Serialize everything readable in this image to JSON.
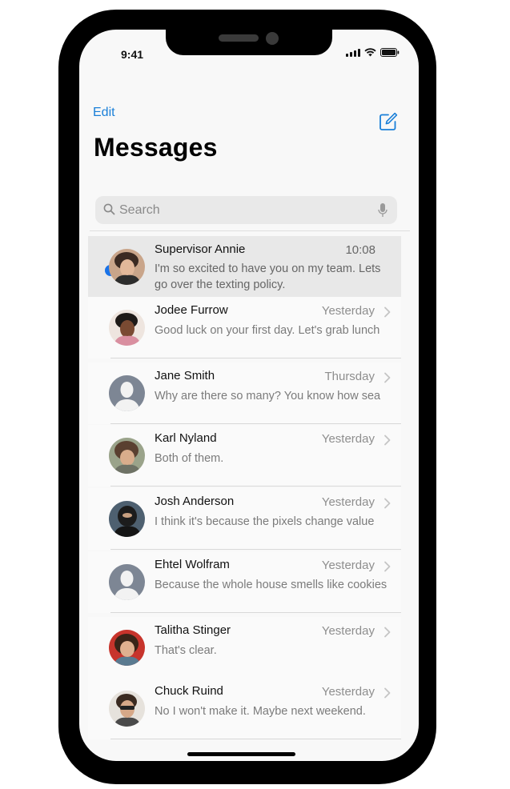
{
  "status_bar": {
    "time": "9:41"
  },
  "header": {
    "edit_label": "Edit",
    "title": "Messages",
    "compose_icon": "compose-icon"
  },
  "search": {
    "placeholder": "Search"
  },
  "colors": {
    "accent": "#1a7fd8",
    "unread_dot": "#1a73e8"
  },
  "conversations": [
    {
      "name": "Supervisor Annie",
      "time": "10:08",
      "preview": "I'm so excited to have you on my team. Lets go over the texting policy.",
      "unread": true,
      "avatar": "photo"
    },
    {
      "name": "Jodee Furrow",
      "time": "Yesterday",
      "preview": "Good luck on your first day. Let's grab lunch",
      "unread": false,
      "avatar": "photo"
    },
    {
      "name": "Jane Smith",
      "time": "Thursday",
      "preview": "Why are there so many? You know how sea",
      "unread": false,
      "avatar": "placeholder"
    },
    {
      "name": "Karl Nyland",
      "time": "Yesterday",
      "preview": "Both of them.",
      "unread": false,
      "avatar": "photo"
    },
    {
      "name": "Josh Anderson",
      "time": "Yesterday",
      "preview": "I think it's because the pixels change value",
      "unread": false,
      "avatar": "photo"
    },
    {
      "name": "Ehtel Wolfram",
      "time": "Yesterday",
      "preview": "Because the whole house smells like cookies",
      "unread": false,
      "avatar": "placeholder"
    },
    {
      "name": "Talitha Stinger",
      "time": "Yesterday",
      "preview": "That's clear.",
      "unread": false,
      "avatar": "photo"
    },
    {
      "name": "Chuck Ruind",
      "time": "Yesterday",
      "preview": "No I won't make it. Maybe next weekend.",
      "unread": false,
      "avatar": "photo"
    }
  ]
}
